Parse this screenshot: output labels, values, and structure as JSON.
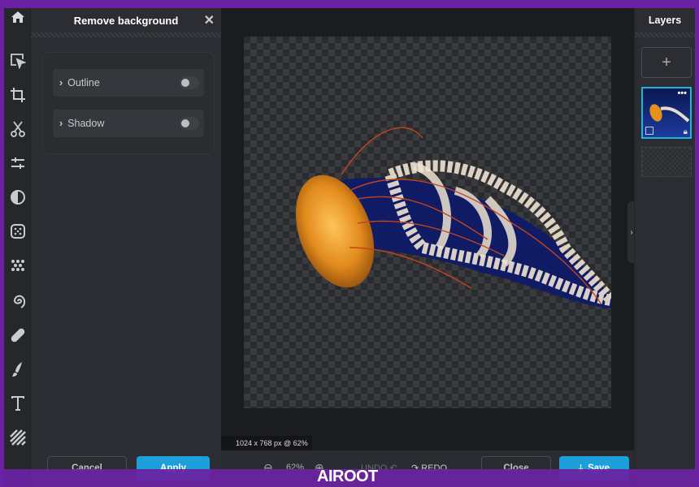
{
  "panel": {
    "title": "Remove background",
    "options": [
      {
        "label": "Outline",
        "enabled": false
      },
      {
        "label": "Shadow",
        "enabled": false
      }
    ],
    "cancel_label": "Cancel",
    "apply_label": "Apply"
  },
  "tools": [
    "home-icon",
    "select-icon",
    "crop-icon",
    "cut-icon",
    "adjust-icon",
    "contrast-icon",
    "filter-icon",
    "effects-icon",
    "liquify-icon",
    "heal-icon",
    "brush-icon",
    "text-icon",
    "pattern-icon"
  ],
  "canvas": {
    "info": "1024 x 768 px @ 62%"
  },
  "bottom": {
    "zoom": "62%",
    "undo_label": "UNDO",
    "redo_label": "REDO",
    "close_label": "Close",
    "save_label": "Save"
  },
  "layers": {
    "title": "Layers"
  },
  "watermark": "AIROOT",
  "colors": {
    "accent": "#1c9fdb",
    "frame": "#6a22a3",
    "selected_layer": "#1fb5d6"
  }
}
